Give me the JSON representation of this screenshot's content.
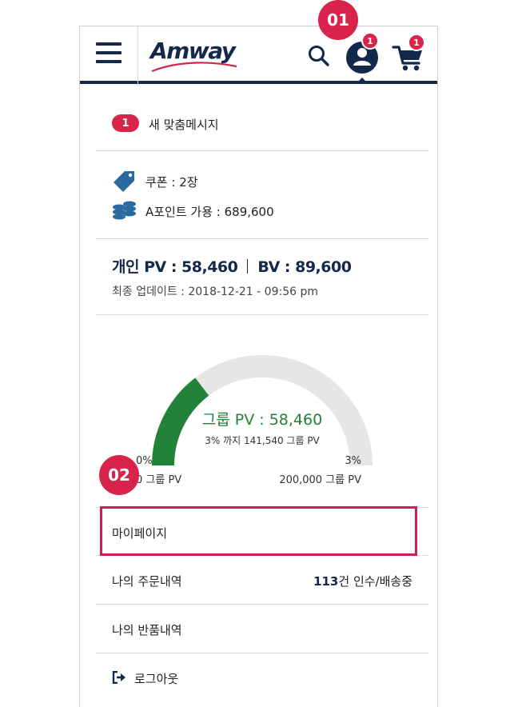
{
  "header": {
    "logo_text": "Amway",
    "account_badge": "1",
    "cart_badge": "1"
  },
  "messages": {
    "count": "1",
    "label": "새 맞춤메시지"
  },
  "benefits": {
    "coupon": "쿠폰 : 2장",
    "points": "A포인트 가용 : 689,600"
  },
  "pv": {
    "personal": "개인  PV : 58,460",
    "bv": "BV : 89,600",
    "updated": "최종 업데이트 : 2018-12-21 - 09:56 pm"
  },
  "gauge": {
    "title": "그룹 PV : 58,460",
    "subtitle": "3% 까지 141,540 그룹 PV",
    "left_percent": "0%",
    "left_value": "0 그룹 PV",
    "right_percent": "3%",
    "right_value": "200,000 그룹 PV",
    "progress_fraction": 0.2923,
    "fill_color": "#238239",
    "track_color": "#e6e6e6"
  },
  "menu": {
    "mypage": "마이페이지",
    "orders": "나의 주문내역",
    "orders_count": "113",
    "orders_status": "건 인수/배송중",
    "returns": "나의 반품내역",
    "logout": "로그아웃"
  },
  "annotations": {
    "step1": "01",
    "step2": "02"
  },
  "colors": {
    "navy": "#13284a",
    "accent_red": "#d8234a",
    "green": "#238239"
  }
}
